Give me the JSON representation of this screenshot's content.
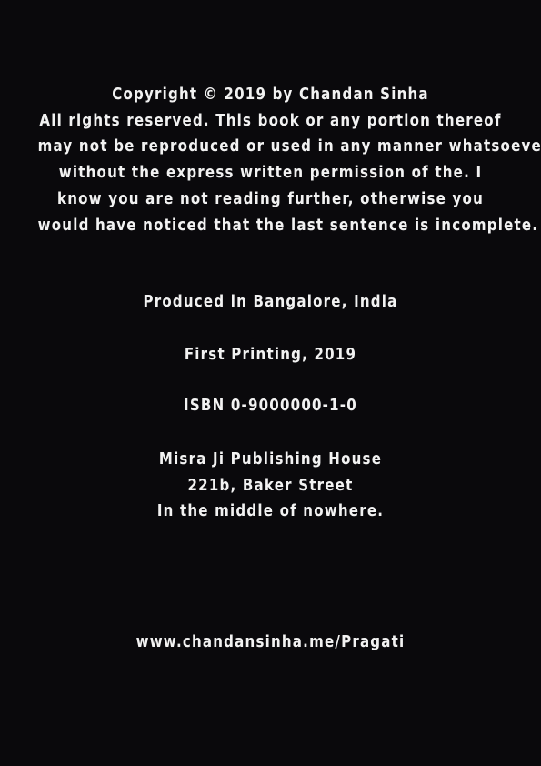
{
  "copyright": {
    "lines": [
      "Copyright © 2019 by Chandan Sinha",
      "All rights reserved. This book or any portion thereof",
      "may not be reproduced or used in any manner whatsoever",
      "without the express written permission of the. I",
      "know you are not reading further, otherwise you",
      "would have noticed that the last sentence is incomplete."
    ]
  },
  "produced": "Produced in Bangalore, India",
  "first_printing": "First Printing, 2019",
  "isbn": "ISBN 0-9000000-1-0",
  "publisher": {
    "name": "Misra Ji Publishing House",
    "address": "221b, Baker Street",
    "location": "In the middle of nowhere."
  },
  "website": "www.chandansinha.me/Pragati",
  "colors": {
    "background": "#0a090c",
    "text": "#f2f2f2"
  }
}
